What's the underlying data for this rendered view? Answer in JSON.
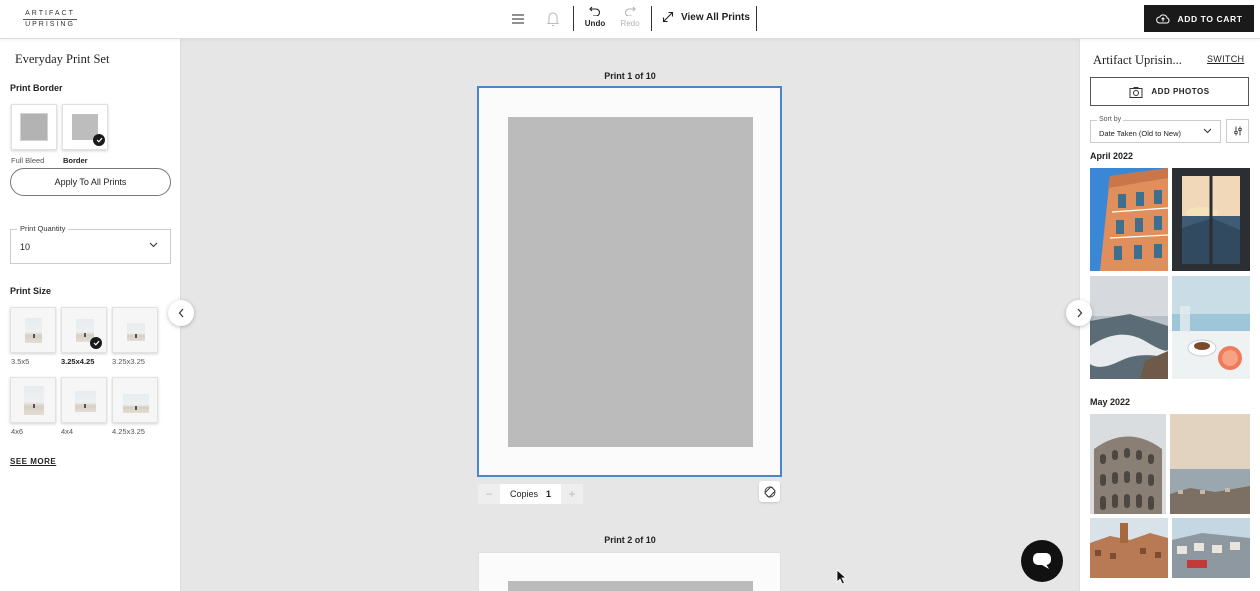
{
  "header": {
    "logo_line1": "ARTIFACT",
    "logo_line2": "UPRISING",
    "menu_icon": "hamburger-icon",
    "bell_icon": "bell-icon",
    "undo_label": "Undo",
    "redo_label": "Redo",
    "view_all_label": "View All Prints",
    "cart_label": "ADD TO CART"
  },
  "left_panel": {
    "title": "Everyday Print Set",
    "border_section": {
      "title": "Print Border",
      "options": [
        {
          "label": "Full Bleed",
          "selected": false
        },
        {
          "label": "Border",
          "selected": true
        }
      ],
      "apply_button": "Apply To All Prints"
    },
    "quantity": {
      "label": "Print Quantity",
      "value": "10"
    },
    "size_section": {
      "title": "Print Size",
      "options": [
        {
          "label": "3.5x5",
          "selected": false
        },
        {
          "label": "3.25x4.25",
          "selected": true
        },
        {
          "label": "3.25x3.25",
          "selected": false
        },
        {
          "label": "4x6",
          "selected": false
        },
        {
          "label": "4x4",
          "selected": false
        },
        {
          "label": "4.25x3.25",
          "selected": false
        }
      ],
      "see_more": "SEE MORE"
    }
  },
  "canvas": {
    "prints": [
      {
        "label": "Print 1 of 10",
        "copies_label": "Copies",
        "copies": "1",
        "selected": true
      },
      {
        "label": "Print 2 of 10"
      }
    ],
    "minus": "−",
    "plus": "+"
  },
  "right_panel": {
    "store_name": "Artifact Uprisin...",
    "switch_label": "SWITCH",
    "add_photos_label": "ADD PHOTOS",
    "sort": {
      "label": "Sort by",
      "value": "Date Taken (Old to New)"
    },
    "groups": [
      {
        "month": "April 2022",
        "photos": [
          "building-facade-photo",
          "window-sea-view-photo",
          "ocean-waves-photo",
          "breakfast-table-photo"
        ]
      },
      {
        "month": "May 2022",
        "photos": [
          "colosseum-photo",
          "coastal-town-photo",
          "rooftops-photo",
          "harbor-town-photo"
        ]
      }
    ]
  },
  "colors": {
    "accent_selected": "#4a86c8",
    "cart_bg": "#1a1a1a",
    "canvas_bg": "#e6e6e6",
    "photo_placeholder": "#bbbbbb"
  }
}
